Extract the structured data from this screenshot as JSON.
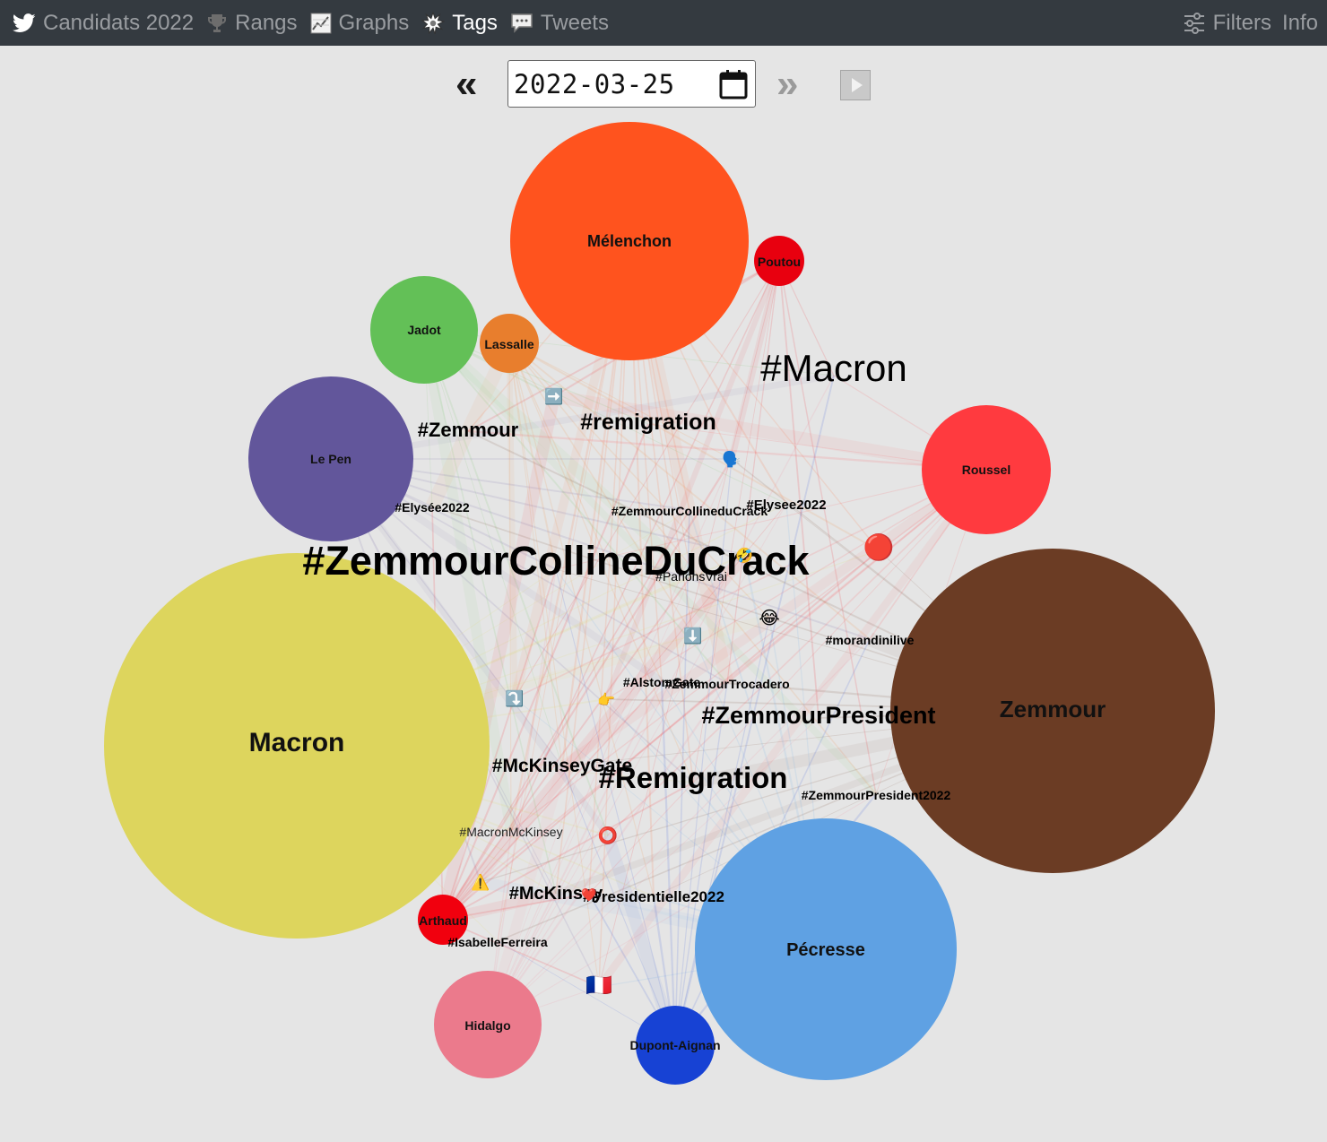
{
  "nav": {
    "candidates": "Candidats 2022",
    "ranks": "Rangs",
    "graphs": "Graphs",
    "tags": "Tags",
    "tweets": "Tweets",
    "filters": "Filters",
    "info": "Info"
  },
  "datebar": {
    "prev": "«",
    "date": "2022-03-25",
    "next": "»"
  },
  "candidates": [
    {
      "key": "melenchon",
      "name": "Mélenchon",
      "color": "#ff531e"
    },
    {
      "key": "poutou",
      "name": "Poutou",
      "color": "#e8000f"
    },
    {
      "key": "jadot",
      "name": "Jadot",
      "color": "#63c057"
    },
    {
      "key": "lassalle",
      "name": "Lassalle",
      "color": "#e87e2d"
    },
    {
      "key": "lepen",
      "name": "Le Pen",
      "color": "#62569b"
    },
    {
      "key": "roussel",
      "name": "Roussel",
      "color": "#ff3a3f"
    },
    {
      "key": "macron",
      "name": "Macron",
      "color": "#ddd55d"
    },
    {
      "key": "zemmour",
      "name": "Zemmour",
      "color": "#6b3c24"
    },
    {
      "key": "pecresse",
      "name": "Pécresse",
      "color": "#5fa1e3"
    },
    {
      "key": "arthaud",
      "name": "Arthaud",
      "color": "#f1000e"
    },
    {
      "key": "hidalgo",
      "name": "Hidalgo",
      "color": "#eb7a8c"
    },
    {
      "key": "dupont",
      "name": "Dupont-Aignan",
      "color": "#1742d4"
    }
  ],
  "tags": [
    {
      "key": "macron-tag",
      "text": "#Macron"
    },
    {
      "key": "remigration-lower",
      "text": "#remigration"
    },
    {
      "key": "zemmour-tag",
      "text": "#Zemmour"
    },
    {
      "key": "elysee2022-accent",
      "text": "#Elysée2022"
    },
    {
      "key": "zemmourcollineducrack-small",
      "text": "#ZemmourCollineduCrack"
    },
    {
      "key": "elysee2022",
      "text": "#Elysee2022"
    },
    {
      "key": "zemmourcollineducrack-big",
      "text": "#ZemmourCollineDuCrack"
    },
    {
      "key": "parlonsvrai",
      "text": "#ParlonsVrai"
    },
    {
      "key": "morandinilive",
      "text": "#morandinilive"
    },
    {
      "key": "alstomgate",
      "text": "#AlstomGate"
    },
    {
      "key": "zemmourtrocadero",
      "text": "#ZemmourTrocadero"
    },
    {
      "key": "zemmourpresident",
      "text": "#ZemmourPresident"
    },
    {
      "key": "mckinseygate",
      "text": "#McKinseyGate"
    },
    {
      "key": "remigration-upper",
      "text": "#Remigration"
    },
    {
      "key": "zemmourpresident2022",
      "text": "#ZemmourPresident2022"
    },
    {
      "key": "macronmckinsey",
      "text": "#MacronMcKinsey"
    },
    {
      "key": "mckinsey",
      "text": "#McKinsey"
    },
    {
      "key": "presidentielle2022",
      "text": "#Presidentielle2022"
    },
    {
      "key": "isabelleferreira",
      "text": "#IsabelleFerreira"
    }
  ],
  "emojis": [
    {
      "key": "arrow-right",
      "glyph": "➡️"
    },
    {
      "key": "speaking-head",
      "glyph": "🗣️"
    },
    {
      "key": "red-circle",
      "glyph": "🔴"
    },
    {
      "key": "rofl",
      "glyph": "🤣"
    },
    {
      "key": "joy",
      "glyph": "😂"
    },
    {
      "key": "arrow-down",
      "glyph": "⬇️"
    },
    {
      "key": "arrow-curve",
      "glyph": "⤵️"
    },
    {
      "key": "point-right",
      "glyph": "👉"
    },
    {
      "key": "hollow-circle",
      "glyph": "⭕"
    },
    {
      "key": "warning",
      "glyph": "⚠️"
    },
    {
      "key": "heart",
      "glyph": "❤️"
    },
    {
      "key": "flag-fr",
      "glyph": "🇫🇷"
    }
  ]
}
